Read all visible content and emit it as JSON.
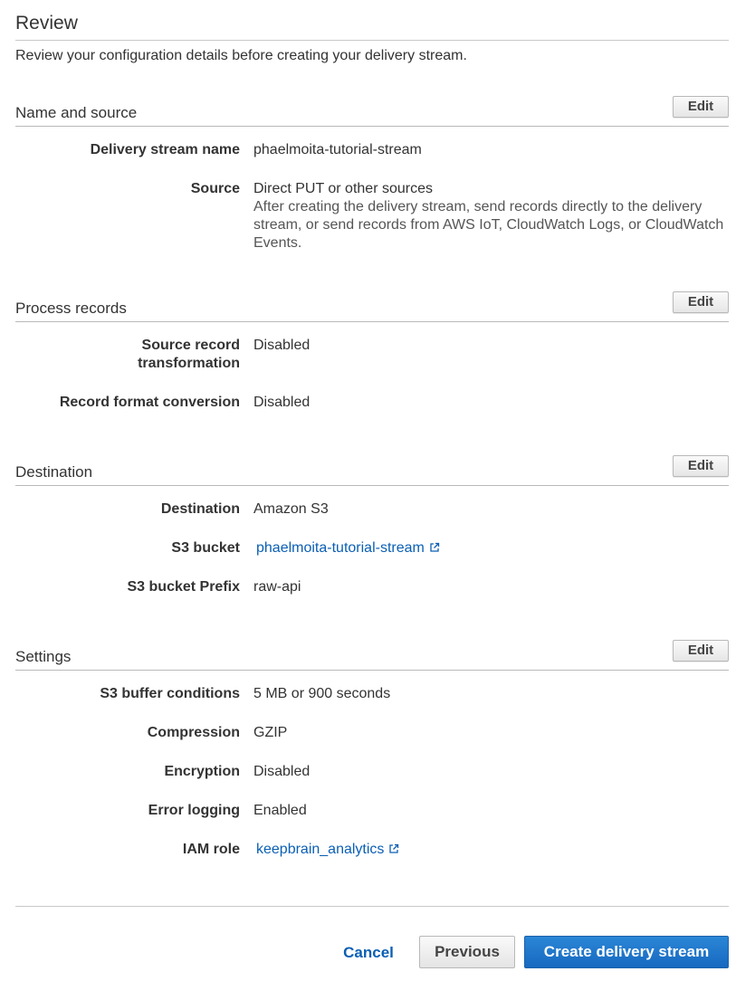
{
  "header": {
    "title": "Review",
    "subtitle": "Review your configuration details before creating your delivery stream."
  },
  "edit_label": "Edit",
  "sections": {
    "name_source": {
      "title": "Name and source",
      "delivery_stream_name_label": "Delivery stream name",
      "delivery_stream_name_value": "phaelmoita-tutorial-stream",
      "source_label": "Source",
      "source_value": "Direct PUT or other sources",
      "source_description": "After creating the delivery stream, send records directly to the delivery stream, or send records from AWS IoT, CloudWatch Logs, or CloudWatch Events."
    },
    "process_records": {
      "title": "Process records",
      "source_record_transformation_label": "Source record transformation",
      "source_record_transformation_value": "Disabled",
      "record_format_conversion_label": "Record format conversion",
      "record_format_conversion_value": "Disabled"
    },
    "destination": {
      "title": "Destination",
      "destination_label": "Destination",
      "destination_value": "Amazon S3",
      "s3_bucket_label": "S3 bucket",
      "s3_bucket_value": "phaelmoita-tutorial-stream",
      "s3_bucket_prefix_label": "S3 bucket Prefix",
      "s3_bucket_prefix_value": "raw-api"
    },
    "settings": {
      "title": "Settings",
      "s3_buffer_conditions_label": "S3 buffer conditions",
      "s3_buffer_conditions_value": "5 MB or 900 seconds",
      "compression_label": "Compression",
      "compression_value": "GZIP",
      "encryption_label": "Encryption",
      "encryption_value": "Disabled",
      "error_logging_label": "Error logging",
      "error_logging_value": "Enabled",
      "iam_role_label": "IAM role",
      "iam_role_value": "keepbrain_analytics"
    }
  },
  "footer": {
    "cancel_label": "Cancel",
    "previous_label": "Previous",
    "create_label": "Create delivery stream"
  },
  "colors": {
    "link": "#0a5fb4",
    "primary_button": "#1769c0",
    "text": "#333333"
  },
  "icons": {
    "external_link": "external-link-icon"
  }
}
